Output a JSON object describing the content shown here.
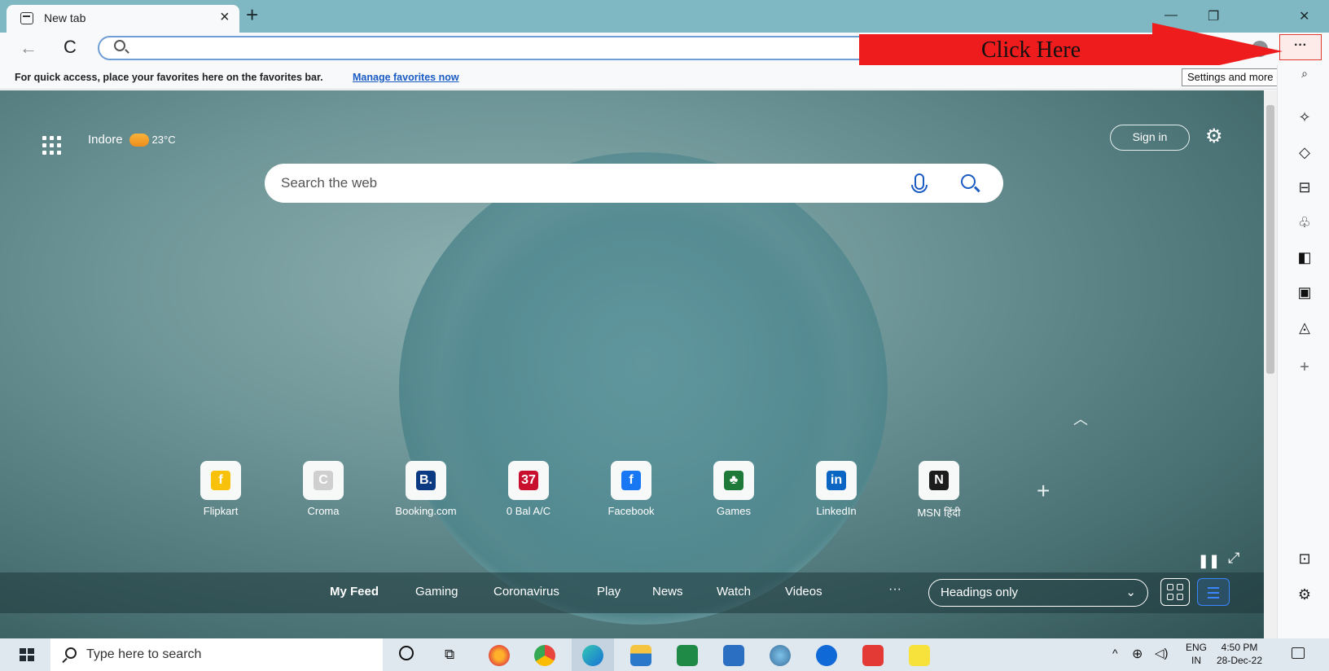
{
  "tab": {
    "title": "New tab",
    "close_glyph": "×",
    "new_tab_glyph": "+"
  },
  "window_controls": {
    "minimize": "—",
    "restore": "❐",
    "close": "✕"
  },
  "toolbar": {
    "back_glyph": "←",
    "reload_glyph": "C",
    "address_value": "",
    "more_label": "···"
  },
  "annotation": {
    "text": "Click Here",
    "color": "#ee1c1c"
  },
  "tooltip": {
    "text": "Settings and more (Alt+F)"
  },
  "favorites_bar": {
    "message": "For quick access, place your favorites here on the favorites bar.",
    "link": "Manage favorites now"
  },
  "header": {
    "location": "Indore",
    "temperature": "23°C",
    "sign_in_label": "Sign in",
    "settings_glyph": "⚙"
  },
  "search": {
    "placeholder": "Search the web"
  },
  "quick_links": [
    {
      "label": "Flipkart",
      "glyph": "f",
      "color": "#f8c20c"
    },
    {
      "label": "Croma",
      "glyph": "C",
      "color": "#cfcfcf"
    },
    {
      "label": "Booking.com",
      "glyph": "B.",
      "color": "#0c3a82"
    },
    {
      "label": "0 Bal A/C",
      "glyph": "37",
      "color": "#c8102e"
    },
    {
      "label": "Facebook",
      "glyph": "f",
      "color": "#1877f2"
    },
    {
      "label": "Games",
      "glyph": "♣",
      "color": "#1f7a3a"
    },
    {
      "label": "LinkedIn",
      "glyph": "in",
      "color": "#0a66c2"
    },
    {
      "label": "MSN हिंदी",
      "glyph": "N",
      "color": "#1c1c1c"
    }
  ],
  "add_tile_glyph": "+",
  "feed": {
    "items": [
      "My Feed",
      "Gaming",
      "Coronavirus",
      "Play",
      "News",
      "Watch",
      "Videos"
    ],
    "more": "···",
    "view_select": "Headings only"
  },
  "sidebar_icons": [
    "search-icon",
    "sparkle-icon",
    "tag-icon",
    "briefcase-icon",
    "games-icon",
    "office-icon",
    "outlook-icon",
    "drop-icon",
    "plus-icon",
    "panel-icon",
    "settings-icon"
  ],
  "taskbar": {
    "search_placeholder": "Type here to search",
    "lang_top": "ENG",
    "lang_bottom": "IN",
    "time": "4:50 PM",
    "date": "28-Dec-22"
  }
}
